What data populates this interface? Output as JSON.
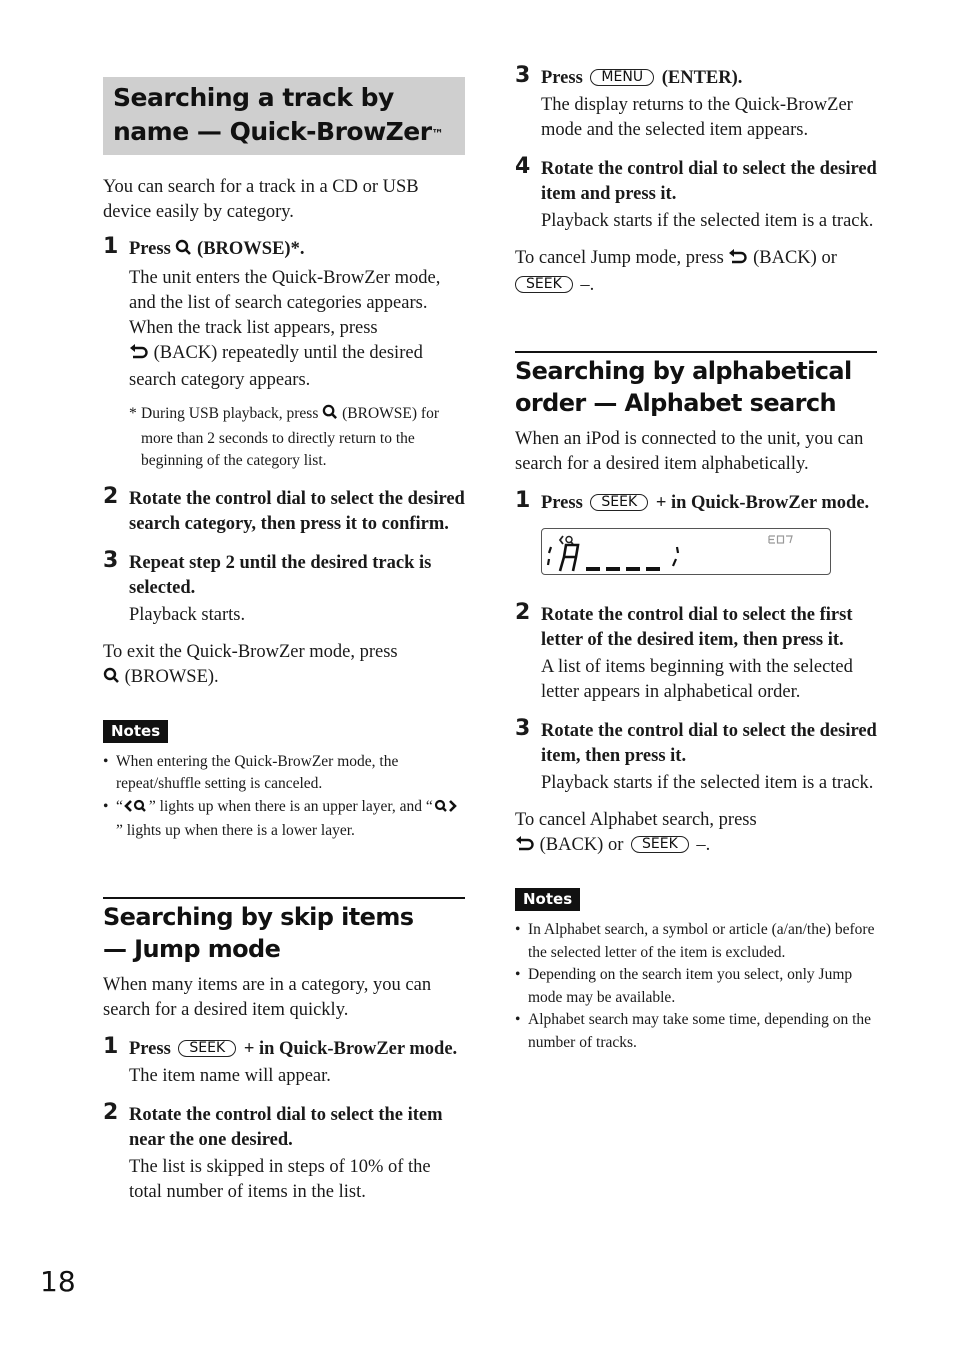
{
  "page_number": "18",
  "left": {
    "section1": {
      "title_line1": "Searching a track by",
      "title_line2": "name — Quick-BrowZer",
      "title_tm": "™",
      "intro": "You can search for a track in a CD or USB device easily by category.",
      "steps": [
        {
          "num": "1",
          "title_pre": "Press",
          "title_post": "(BROWSE)*.",
          "body1": "The unit enters the Quick-BrowZer mode, and the list of search categories appears.",
          "body2_pre": "When the track list appears, press",
          "body2_post": "(BACK) repeatedly until the desired search category appears.",
          "footnote_star": "*",
          "footnote_pre": "During USB playback, press",
          "footnote_post": "(BROWSE) for more than 2 seconds to directly return to the beginning of the category list."
        },
        {
          "num": "2",
          "title": "Rotate the control dial to select the desired search category, then press it to confirm."
        },
        {
          "num": "3",
          "title": "Repeat step 2 until the desired track is selected.",
          "body": "Playback starts."
        }
      ],
      "exit_pre": "To exit the Quick-BrowZer mode, press",
      "exit_post": "(BROWSE).",
      "notes_label": "Notes",
      "notes": [
        "When entering the Quick-BrowZer mode, the repeat/shuffle setting is canceled."
      ],
      "note2_open": "“",
      "note2_mid": "” lights up when there is an upper layer, and “",
      "note2_end": "” lights up when there is a lower layer.",
      "bullet": "•"
    },
    "section2": {
      "title_line1": "Searching by skip items",
      "title_line2": "— Jump mode",
      "intro": "When many items are in a category, you can search for a desired item quickly.",
      "steps": [
        {
          "num": "1",
          "title_pre": "Press",
          "key": "SEEK",
          "title_post": "+ in Quick-BrowZer mode.",
          "body": "The item name will appear."
        },
        {
          "num": "2",
          "title": "Rotate the control dial to select the item near the one desired.",
          "body": "The list is skipped in steps of 10% of the total number of items in the list."
        }
      ]
    }
  },
  "right": {
    "jump_cont": {
      "steps": [
        {
          "num": "3",
          "title_pre": "Press",
          "key": "MENU",
          "title_post": "(ENTER).",
          "body": "The display returns to the Quick-BrowZer mode and the selected item appears."
        },
        {
          "num": "4",
          "title": "Rotate the control dial to select the desired item and press it.",
          "body": "Playback starts if the selected item is a track."
        }
      ],
      "cancel_pre": "To cancel Jump mode, press",
      "cancel_mid": "(BACK) or",
      "cancel_key": "SEEK",
      "cancel_post": "–."
    },
    "section3": {
      "title_line1": "Searching by alphabetical",
      "title_line2": "order — Alphabet search",
      "intro": "When an iPod is connected to the unit, you can search for a desired item alphabetically.",
      "steps": [
        {
          "num": "1",
          "title_pre": "Press",
          "key": "SEEK",
          "title_post": "+ in Quick-BrowZer mode."
        },
        {
          "num": "2",
          "title": "Rotate the control dial to select the first letter of the desired item, then press it.",
          "body": "A list of items beginning with the selected letter appears in alphabetical order."
        },
        {
          "num": "3",
          "title": "Rotate the control dial to select the desired item, then press it.",
          "body": "Playback starts if the selected item is a track."
        }
      ],
      "lcd": {
        "indicator": "upper-layer-icon",
        "eq_label": "EQ7",
        "text": "'A____'"
      },
      "cancel_pre": "To cancel Alphabet search, press",
      "cancel_mid": "(BACK) or",
      "cancel_key": "SEEK",
      "cancel_post": "–.",
      "notes_label": "Notes",
      "notes": [
        "In Alphabet search, a symbol or article (a/an/the) before the selected letter of the item is excluded.",
        "Depending on the search item you select, only Jump mode may be available.",
        "Alphabet search may take some time, depending on the number of tracks."
      ],
      "bullet": "•"
    }
  }
}
